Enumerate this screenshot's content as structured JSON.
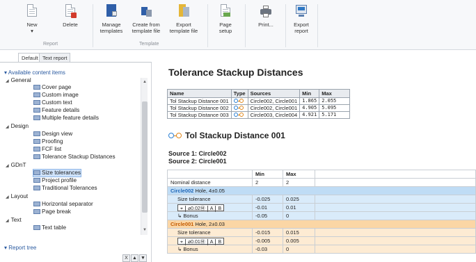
{
  "ribbon": {
    "buttons": [
      {
        "id": "new",
        "label": "New",
        "sub": "▾",
        "icon": "new-document-icon"
      },
      {
        "id": "delete",
        "label": "Delete",
        "icon": "delete-document-icon"
      },
      {
        "id": "manage",
        "label": "Manage templates",
        "icon": "manage-templates-icon"
      },
      {
        "id": "create",
        "label": "Create from template file",
        "icon": "create-from-template-icon"
      },
      {
        "id": "export_tpl",
        "label": "Export template file",
        "icon": "export-template-icon"
      },
      {
        "id": "page_setup",
        "label": "Page setup",
        "icon": "page-setup-icon"
      },
      {
        "id": "print",
        "label": "Print...",
        "icon": "printer-icon"
      },
      {
        "id": "export_report",
        "label": "Export report",
        "icon": "export-report-icon"
      }
    ],
    "groups": {
      "report": "Report",
      "template": "Template"
    }
  },
  "tabs": [
    "Default",
    "Text report"
  ],
  "left": {
    "available_title": "Available content items",
    "categories": {
      "general": "General",
      "design": "Design",
      "gdnt": "GDnT",
      "layout": "Layout",
      "text": "Text"
    },
    "items": {
      "cover": "Cover page",
      "custom_image": "Custom image",
      "custom_text": "Custom text",
      "feature_details": "Feature details",
      "multi_feature": "Multiple feature details",
      "design_view": "Design view",
      "proofing": "Proofing",
      "fcf_list": "FCF list",
      "tol_stack": "Tolerance Stackup Distances",
      "size_tol": "Size tolerances",
      "project_profile": "Project profile",
      "traditional": "Traditional Tolerances",
      "hsep": "Horizontal separator",
      "page_break": "Page break",
      "text_table": "Text table"
    },
    "report_tree": "Report tree",
    "buttons": {
      "close": "X",
      "up": "▲",
      "down": "▼"
    }
  },
  "content": {
    "title": "Tolerance Stackup Distances",
    "summary_headers": [
      "Name",
      "Type",
      "Sources",
      "Min",
      "Max"
    ],
    "summary_rows": [
      {
        "name": "Tol Stackup Distance 001",
        "sources": "Circle002, Circle001",
        "min": "1.865",
        "max": "2.055"
      },
      {
        "name": "Tol Stackup Distance 002",
        "sources": "Circle002, Circle001",
        "min": "4.905",
        "max": "5.095"
      },
      {
        "name": "Tol Stackup Distance 003",
        "sources": "Circle003, Circle004",
        "min": "4.921",
        "max": "5.171"
      }
    ],
    "detail_title": "Tol Stackup Distance 001",
    "source1": "Source 1: Circle002",
    "source2": "Source 2: Circle001",
    "detail_headers": {
      "min": "Min",
      "max": "Max"
    },
    "nominal": {
      "label": "Nominal distance",
      "min": "2",
      "max": "2"
    },
    "circle_a": {
      "name": "Circle002",
      "desc": "Hole, 4±0.05",
      "size_tol": {
        "label": "Size tolerance",
        "min": "-0.025",
        "max": "0.025"
      },
      "fcf": {
        "symbol": "⌖",
        "tol": "⌀0.02Ⓜ",
        "a": "A",
        "b": "B",
        "min": "-0.01",
        "max": "0.01"
      },
      "bonus": {
        "label": "↳ Bonus",
        "min": "-0.05",
        "max": "0"
      }
    },
    "circle_b": {
      "name": "Circle001",
      "desc": "Hole, 2±0.03",
      "size_tol": {
        "label": "Size tolerance",
        "min": "-0.015",
        "max": "0.015"
      },
      "fcf": {
        "symbol": "⌖",
        "tol": "⌀0.01Ⓜ",
        "a": "A",
        "b": "B",
        "min": "-0.005",
        "max": "0.005"
      },
      "bonus": {
        "label": "↳ Bonus",
        "min": "-0.03",
        "max": "0"
      }
    }
  }
}
